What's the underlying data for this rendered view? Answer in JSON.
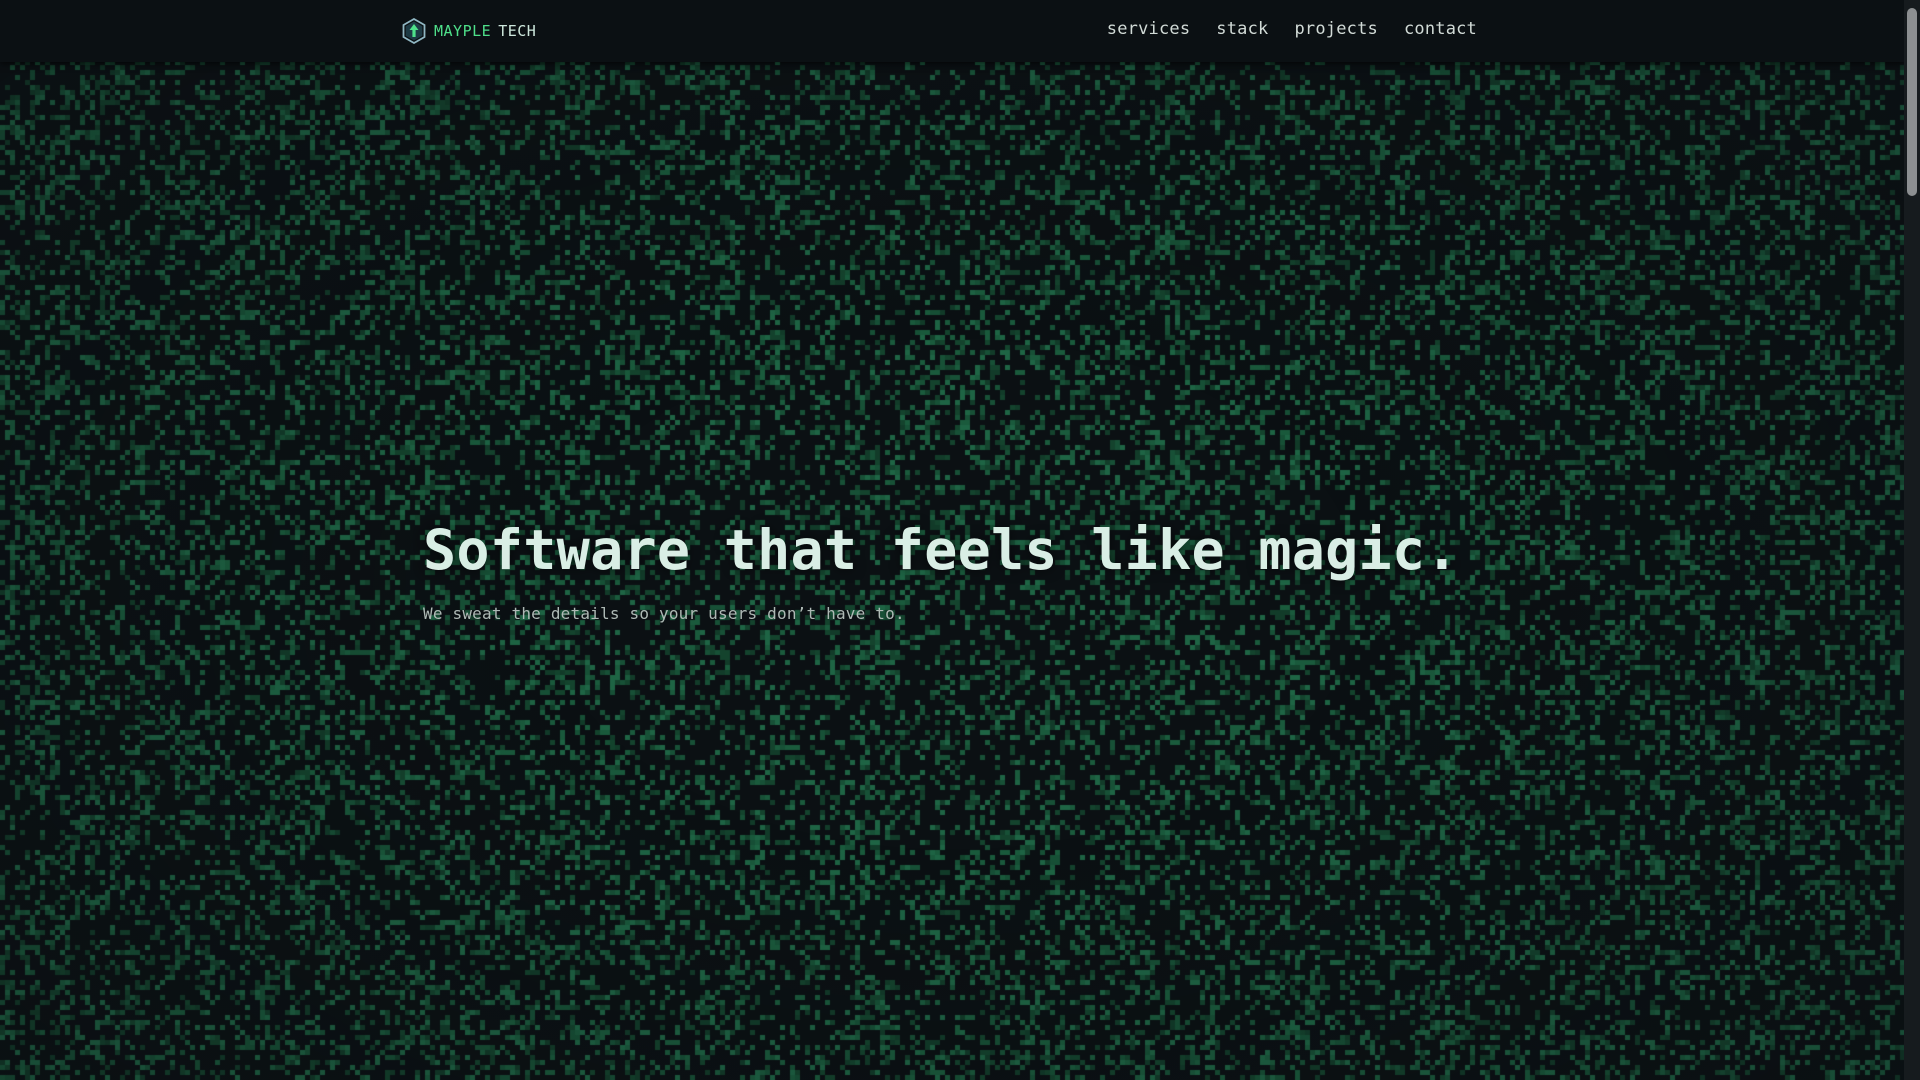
{
  "brand": {
    "primary": "MAYPLE",
    "secondary": "TECH",
    "logo_icon": "hexagon-arrow-up-icon"
  },
  "nav": {
    "items": [
      {
        "label": "services"
      },
      {
        "label": "stack"
      },
      {
        "label": "projects"
      },
      {
        "label": "contact"
      }
    ]
  },
  "hero": {
    "title": "Software that feels like magic.",
    "subtitle": "We sweat the details so your users don’t have to."
  },
  "background": {
    "style": "pixel-noise",
    "base_color": "#0b1013",
    "pixel_color": "#1c5a3d"
  },
  "colors": {
    "accent": "#4ee08a",
    "text": "#d9eee5"
  }
}
